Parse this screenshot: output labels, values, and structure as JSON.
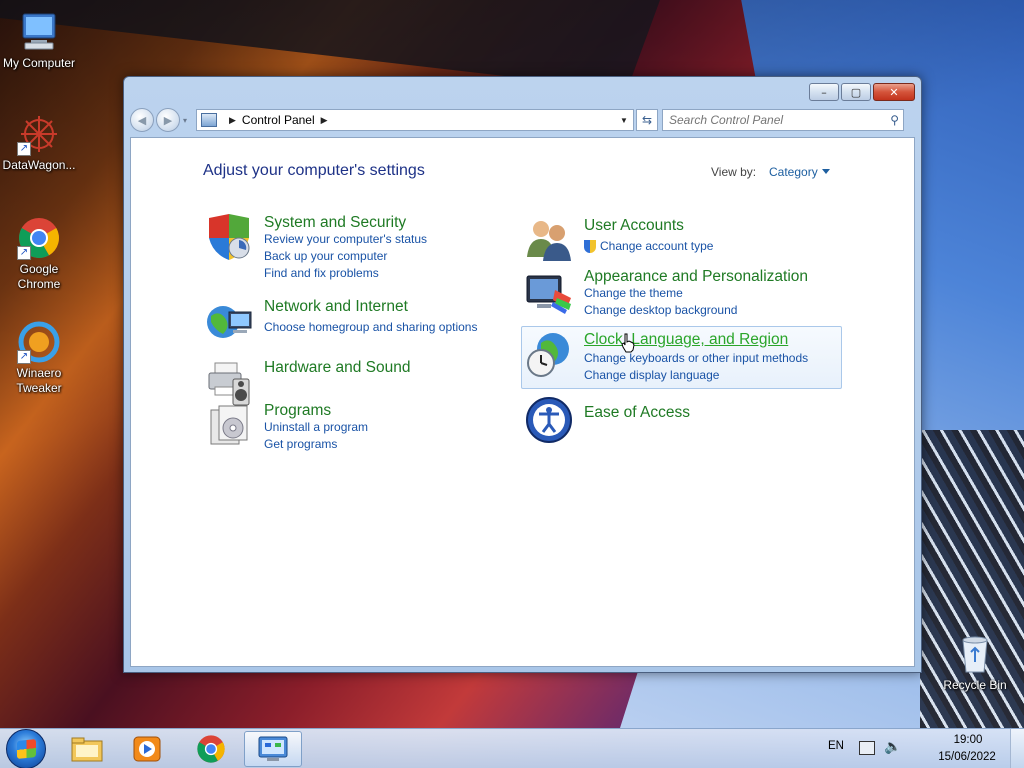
{
  "desktop": {
    "icons": [
      {
        "label": "My Computer",
        "icon": "computer-icon"
      },
      {
        "label": "DataWagon...",
        "icon": "datawagon-icon"
      },
      {
        "label": "Google Chrome",
        "icon": "chrome-icon"
      },
      {
        "label": "Winaero Tweaker",
        "icon": "winaero-icon"
      },
      {
        "label": "Recycle Bin",
        "icon": "recycle-bin-icon"
      }
    ]
  },
  "window": {
    "controls": {
      "minimize": "–",
      "maximize": "▢",
      "close": "✕"
    },
    "address": {
      "root": "Control Panel"
    },
    "search": {
      "placeholder": "Search Control Panel"
    },
    "heading": "Adjust your computer's settings",
    "view_by": {
      "label": "View by:",
      "value": "Category"
    }
  },
  "categories": {
    "system_security": {
      "title": "System and Security",
      "links": [
        "Review your computer's status",
        "Back up your computer",
        "Find and fix problems"
      ],
      "icon": "shield-icon"
    },
    "network_internet": {
      "title": "Network and Internet",
      "links": [
        "Choose homegroup and sharing options"
      ],
      "icon": "network-globe-icon"
    },
    "hardware_sound": {
      "title": "Hardware and Sound",
      "links": [],
      "icon": "printer-speaker-icon"
    },
    "programs": {
      "title": "Programs",
      "links": [
        "Uninstall a program",
        "Get programs"
      ],
      "icon": "programs-box-icon"
    },
    "user_accounts": {
      "title": "User Accounts",
      "links": [
        "Change account type"
      ],
      "icon": "users-icon"
    },
    "appearance": {
      "title": "Appearance and Personalization",
      "links": [
        "Change the theme",
        "Change desktop background"
      ],
      "icon": "monitor-paint-icon"
    },
    "clock_region": {
      "title": "Clock, Language, and Region",
      "links": [
        "Change keyboards or other input methods",
        "Change display language"
      ],
      "icon": "clock-globe-icon"
    },
    "ease_access": {
      "title": "Ease of Access",
      "links": [],
      "icon": "ease-of-access-icon"
    }
  },
  "taskbar": {
    "buttons": [
      "start-button",
      "explorer-icon",
      "media-player-icon",
      "chrome-icon",
      "control-panel-icon"
    ],
    "tray": {
      "language": "EN",
      "time": "19:00",
      "date": "15/06/2022"
    }
  }
}
